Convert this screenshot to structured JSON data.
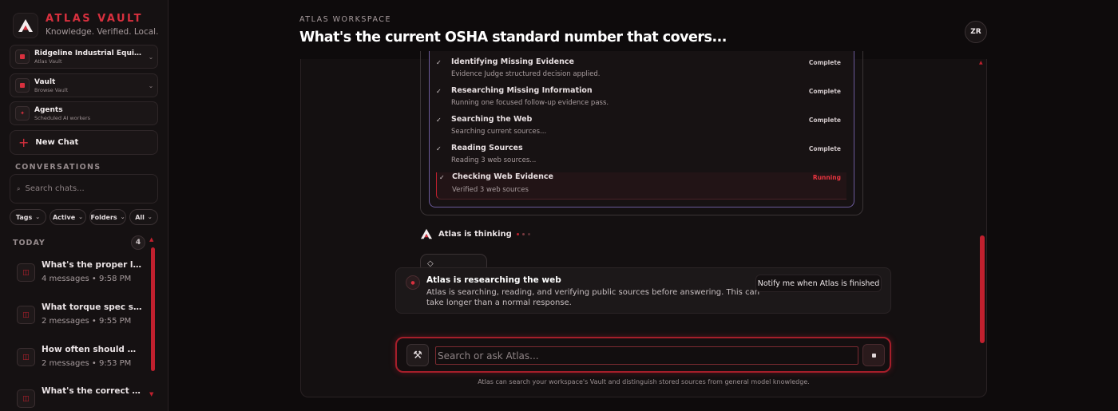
{
  "brand": {
    "title": "ATLAS VAULT",
    "tagline": "Knowledge. Verified. Local."
  },
  "nav": {
    "workspace": {
      "title": "Ridgeline Industrial Equipme...",
      "subtitle": "Atlas Vault"
    },
    "vault": {
      "title": "Vault",
      "subtitle": "Browse Vault"
    },
    "agents": {
      "title": "Agents",
      "subtitle": "Scheduled AI workers"
    }
  },
  "new_chat_label": "New Chat",
  "conversations_label": "CONVERSATIONS",
  "search_placeholder": "Search chats...",
  "filters": [
    "Tags",
    "Active",
    "Folders",
    "All"
  ],
  "today_label": "TODAY",
  "today_count": "4",
  "conversations": [
    {
      "title": "What's the proper lock...",
      "messages": "4 messages",
      "time": "9:58 PM"
    },
    {
      "title": "What torque spec shou...",
      "messages": "2 messages",
      "time": "9:55 PM"
    },
    {
      "title": "How often should we t...",
      "messages": "2 messages",
      "time": "9:53 PM"
    },
    {
      "title": "What's the correct fra...",
      "messages": "",
      "time": ""
    }
  ],
  "header": {
    "eyebrow": "ATLAS WORKSPACE",
    "title": "What's the current OSHA standard number that covers...",
    "avatar_initials": "ZR"
  },
  "steps": [
    {
      "title": "Identifying Missing Evidence",
      "detail": "Evidence Judge structured decision applied.",
      "status": "Complete"
    },
    {
      "title": "Researching Missing Information",
      "detail": "Running one focused follow-up evidence pass.",
      "status": "Complete"
    },
    {
      "title": "Searching the Web",
      "detail": "Searching current sources...",
      "status": "Complete"
    },
    {
      "title": "Reading Sources",
      "detail": "Reading 3 web sources...",
      "status": "Complete"
    },
    {
      "title": "Checking Web Evidence",
      "detail": "Verified 3 web sources",
      "status": "Running"
    }
  ],
  "thinking_label": "Atlas is thinking",
  "intelligence_label": "◇ Intelligence",
  "research": {
    "title": "Atlas is researching the web",
    "body": "Atlas is searching, reading, and verifying public sources before answering. This can take longer than a normal response.",
    "notify_label": "Notify me when Atlas is finished"
  },
  "composer": {
    "placeholder": "Search or ask Atlas..."
  },
  "footer_note": "Atlas can search your workspace's Vault and distinguish stored sources from general model knowledge.",
  "colors": {
    "accent": "#d8303e",
    "background": "#0e0b0c",
    "sidebar": "#151112"
  }
}
